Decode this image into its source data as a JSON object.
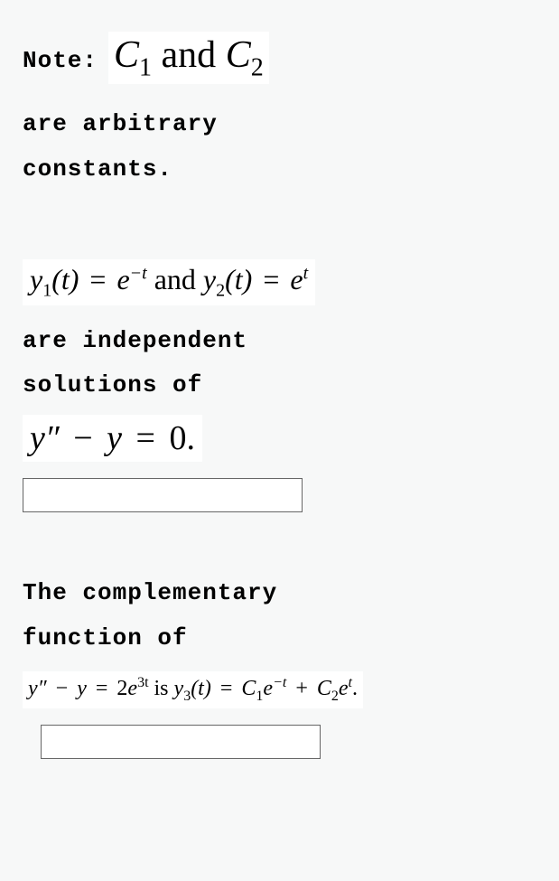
{
  "note": {
    "label": "Note:",
    "math_c1": "C",
    "math_sub1": "1",
    "math_and": " and ",
    "math_c2": "C",
    "math_sub2": "2",
    "line2": "are arbitrary",
    "line3": "constants."
  },
  "block2": {
    "y1": "y",
    "y1sub": "1",
    "tparen": "(t)",
    "eq": " = ",
    "e": "e",
    "negt": "−t",
    "and": " and ",
    "y2": "y",
    "y2sub": "2",
    "tparen2": "(t)",
    "eq2": " = ",
    "e2": "e",
    "t": "t",
    "line2": "are independent",
    "line3": "solutions of",
    "ode_y": "y",
    "ode_pp": "″",
    "ode_minus": " − ",
    "ode_y2": "y",
    "ode_eq": " = ",
    "ode_zero": "0.",
    "input_value": ""
  },
  "block3": {
    "line1": "The complementary",
    "line2": "function of",
    "ode_y": "y",
    "ode_pp": "″",
    "ode_minus": " − ",
    "ode_y2": "y",
    "ode_eq": " = ",
    "two": "2",
    "e": "e",
    "threet": "3t",
    "is": " is ",
    "y3": "y",
    "y3sub": "3",
    "tparen": "(t)",
    "eq2": " = ",
    "c1": "C",
    "c1sub": "1",
    "e2": "e",
    "negt": "−t",
    "plus": " + ",
    "c2": "C",
    "c2sub": "2",
    "e3": "e",
    "t": "t",
    "period": ".",
    "input_value": ""
  }
}
